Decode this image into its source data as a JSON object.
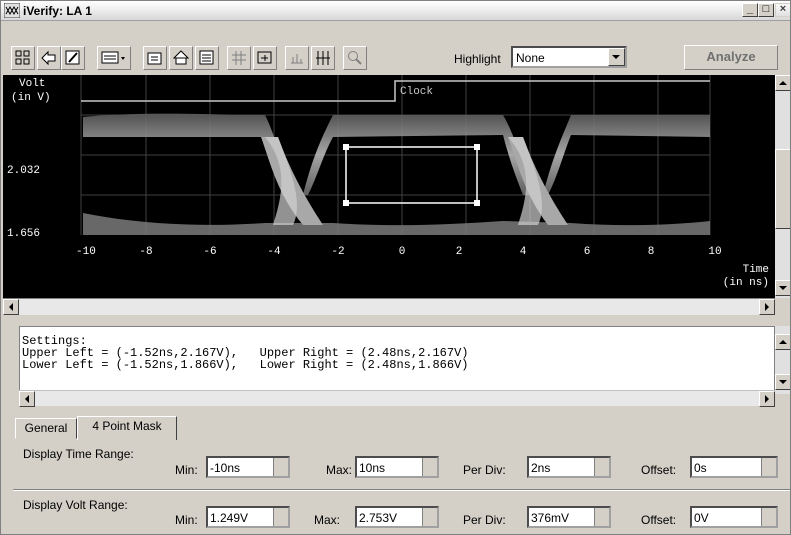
{
  "window": {
    "title": "iVerify: LA 1"
  },
  "toolbar": {
    "highlight_label": "Highlight",
    "highlight_value": "None",
    "analyze_label": "Analyze"
  },
  "plot": {
    "y_label_line1": "Volt",
    "y_label_line2": "(in V)",
    "y_ticks": [
      "2.032",
      "1.656"
    ],
    "x_ticks": [
      "-10",
      "-8",
      "-6",
      "-4",
      "-2",
      "0",
      "2",
      "4",
      "6",
      "8",
      "10"
    ],
    "x_label_line1": "Time",
    "x_label_line2": "(in ns)",
    "signal_label": "Clock"
  },
  "settings": {
    "text": "Settings:\nUpper Left = (-1.52ns,2.167V),   Upper Right = (2.48ns,2.167V)\nLower Left = (-1.52ns,1.866V),   Lower Right = (2.48ns,1.866V)"
  },
  "tabs": [
    {
      "label": "General"
    },
    {
      "label": "4 Point Mask"
    }
  ],
  "time_range": {
    "label": "Display Time Range:",
    "min_label": "Min:",
    "min_value": "-10ns",
    "max_label": "Max:",
    "max_value": "10ns",
    "perdiv_label": "Per Div:",
    "perdiv_value": "2ns",
    "offset_label": "Offset:",
    "offset_value": "0s"
  },
  "volt_range": {
    "label": "Display Volt Range:",
    "min_label": "Min:",
    "min_value": "1.249V",
    "max_label": "Max:",
    "max_value": "2.753V",
    "perdiv_label": "Per Div:",
    "perdiv_value": "376mV",
    "offset_label": "Offset:",
    "offset_value": "0V"
  },
  "icons": [
    "app-icon",
    "minimize-icon",
    "maximize-icon",
    "close-icon",
    "toolbar-icons",
    "dropdown-arrow-icon",
    "scroll-arrow-icons",
    "spin-arrow-icons"
  ]
}
